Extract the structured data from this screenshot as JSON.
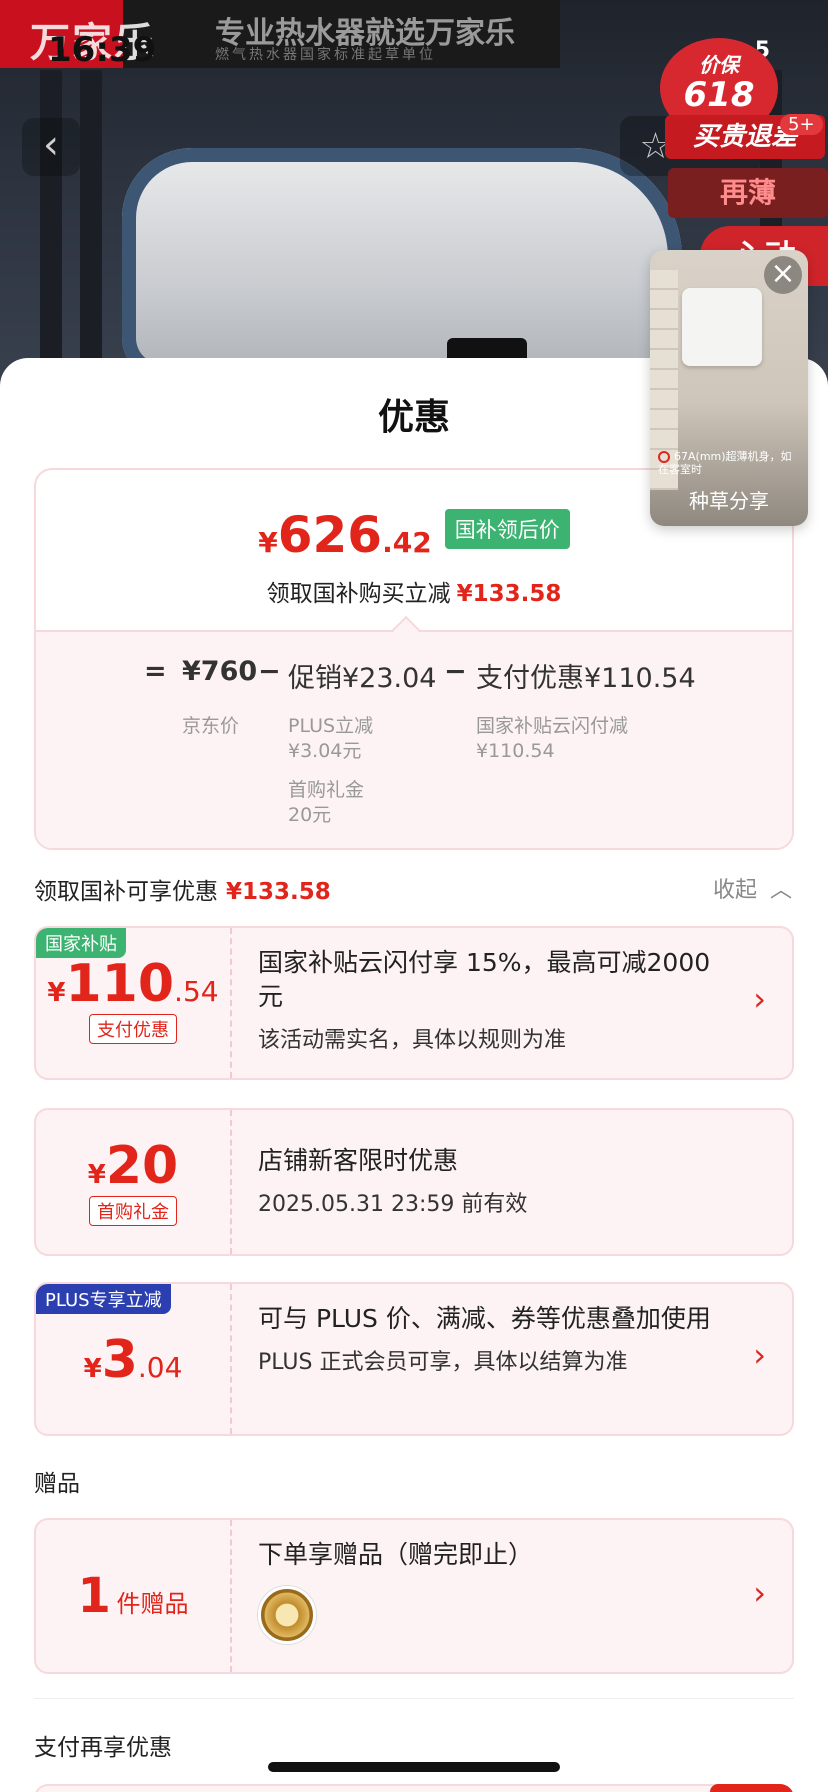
{
  "status": {
    "time": "16:39",
    "battery": "5"
  },
  "hero": {
    "brand": "万家乐",
    "slogan": "专业热水器就选万家乐",
    "slogan_sub": "燃气热水器国家标准起草单位",
    "promo_top": "价保",
    "promo_618": "618",
    "promo_buy": "买贵退差",
    "promo_count": "5+",
    "promo_mid": "再薄",
    "promo_low": "心动"
  },
  "floating_video": {
    "caption": "67A(mm)超薄机身，如在客室时",
    "label": "种草分享"
  },
  "sheet": {
    "title": "优惠",
    "summary": {
      "currency": "¥",
      "price_int": "626",
      "price_dec": ".42",
      "price_tag": "国补领后价",
      "save_text": "领取国补购买立减",
      "save_amount": "¥133.58",
      "eq": "=",
      "base_price": "¥760",
      "base_label": "京东价",
      "minus1": "−",
      "promo_label": "促销¥23.04",
      "promo_sub1": "PLUS立减",
      "promo_sub1_val": "¥3.04元",
      "promo_sub2": "首购礼金",
      "promo_sub2_val": "20元",
      "minus2": "−",
      "pay_label": "支付优惠¥110.54",
      "pay_sub": "国家补贴云闪付减",
      "pay_sub_val": "¥110.54"
    },
    "section1": {
      "title": "领取国补可享优惠",
      "amount": "¥133.58",
      "collapse": "收起"
    },
    "coupons": [
      {
        "corner": "国家补贴",
        "cur": "¥",
        "int": "110",
        "dec": ".54",
        "tag": "支付优惠",
        "title": "国家补贴云闪付享 15%，最高可减2000 元",
        "sub": "该活动需实名，具体以规则为准"
      },
      {
        "cur": "¥",
        "int": "20",
        "dec": "",
        "tag": "首购礼金",
        "title": "店铺新客限时优惠",
        "sub": "2025.05.31 23:59 前有效"
      },
      {
        "corner": "PLUS专享立减",
        "cur": "¥",
        "int": "3",
        "dec": ".04",
        "title": "可与 PLUS 价、满减、券等优惠叠加使用",
        "sub": "PLUS 正式会员可享，具体以结算为准"
      }
    ],
    "gift_section": {
      "title": "赠品",
      "count": "1",
      "unit": "件赠品",
      "title_text": "下单享赠品（赠完即止）"
    },
    "pay_section": {
      "title": "支付再享优惠"
    }
  },
  "colors": {
    "accent": "#e1251b",
    "green_tag": "#3cb371",
    "plus_tag": "#2b3fb0"
  }
}
